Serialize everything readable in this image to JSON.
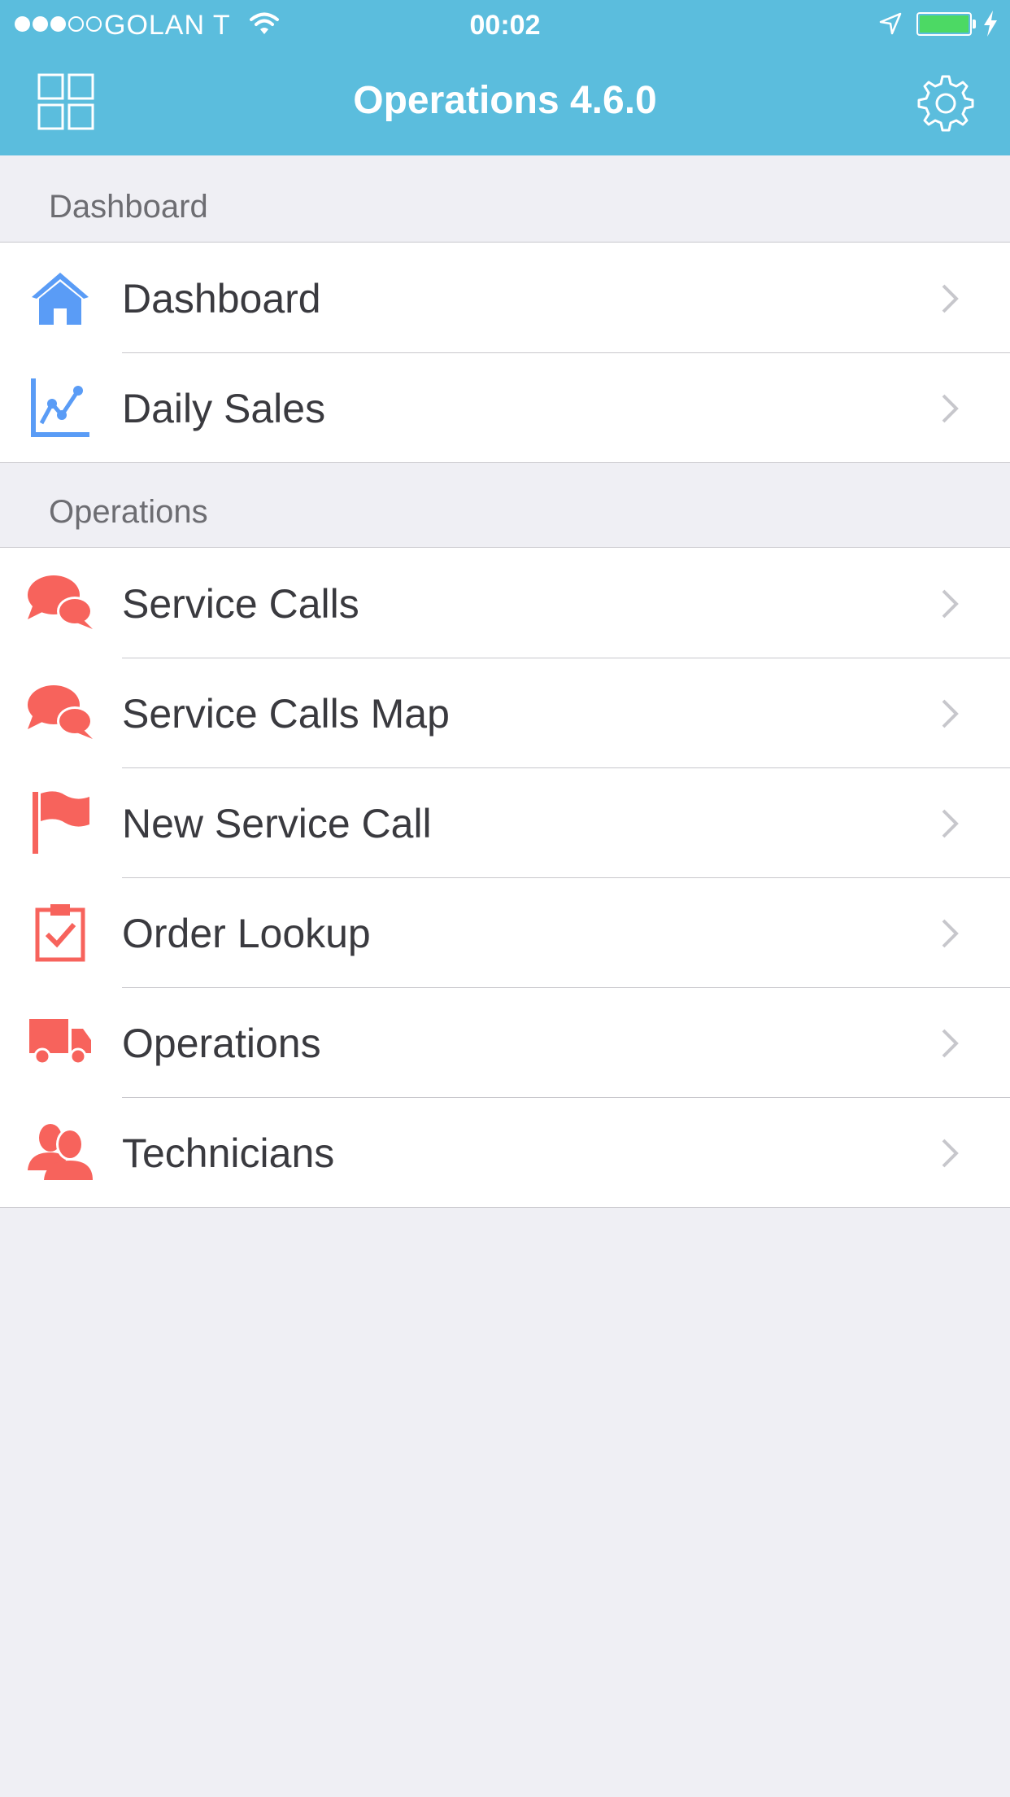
{
  "status_bar": {
    "carrier": "GOLAN T",
    "time": "00:02",
    "signal_bars_filled": 3,
    "signal_bars_total": 5,
    "battery_level": 1.0,
    "battery_color": "#4cd964",
    "icons": [
      "signal-dots",
      "wifi-icon",
      "location-arrow-icon",
      "battery-icon",
      "charging-bolt-icon"
    ]
  },
  "nav_bar": {
    "title": "Operations 4.6.0",
    "left_icon": "grid-icon",
    "right_icon": "gear-icon",
    "background": "#5bbddd"
  },
  "sections": [
    {
      "header": "Dashboard",
      "items": [
        {
          "label": "Dashboard",
          "icon": "home-icon"
        },
        {
          "label": "Daily Sales",
          "icon": "line-chart-icon"
        }
      ]
    },
    {
      "header": "Operations",
      "items": [
        {
          "label": "Service Calls",
          "icon": "chat-bubbles-icon"
        },
        {
          "label": "Service Calls Map",
          "icon": "chat-bubbles-icon"
        },
        {
          "label": "New Service Call",
          "icon": "flag-icon"
        },
        {
          "label": "Order Lookup",
          "icon": "clipboard-check-icon"
        },
        {
          "label": "Operations",
          "icon": "truck-icon"
        },
        {
          "label": "Technicians",
          "icon": "users-icon"
        }
      ]
    }
  ],
  "colors": {
    "accent_blue_icon": "#5a9cf6",
    "accent_red_icon": "#f7635c",
    "background": "#efeff4",
    "label": "#3a3a3f",
    "section_header": "#6d6d72"
  }
}
